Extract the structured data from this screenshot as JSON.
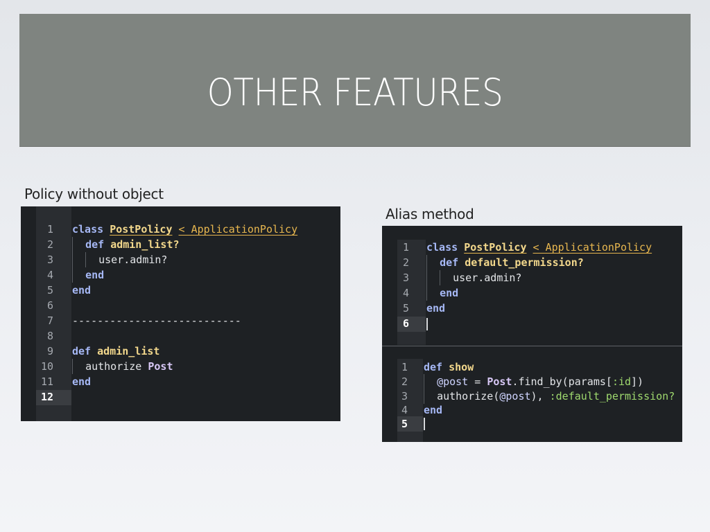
{
  "slide": {
    "title": "OTHER FEATURES"
  },
  "left_example": {
    "caption": "Policy without object",
    "line_numbers": [
      "1",
      "2",
      "3",
      "4",
      "5",
      "6",
      "7",
      "8",
      "9",
      "10",
      "11",
      "12"
    ],
    "lines": {
      "l1": {
        "kw": "class",
        "cls": "PostPolicy",
        "sup": "< ApplicationPolicy"
      },
      "l2": {
        "kw": "def",
        "fn": "admin_list?"
      },
      "l3": {
        "text": "user.admin?"
      },
      "l4": {
        "kw": "end"
      },
      "l5": {
        "kw": "end"
      },
      "l7": {
        "text": "---------------------------"
      },
      "l9": {
        "kw": "def",
        "fn": "admin_list"
      },
      "l10": {
        "text": "authorize",
        "const": "Post"
      },
      "l11": {
        "kw": "end"
      }
    }
  },
  "right_example": {
    "caption": "Alias method",
    "top_line_numbers": [
      "1",
      "2",
      "3",
      "4",
      "5",
      "6"
    ],
    "bottom_line_numbers": [
      "1",
      "2",
      "3",
      "4",
      "5"
    ],
    "top_lines": {
      "l1": {
        "kw": "class",
        "cls": "PostPolicy",
        "sup": "< ApplicationPolicy"
      },
      "l2": {
        "kw": "def",
        "fn": "default_permission?"
      },
      "l3": {
        "text": "user.admin?"
      },
      "l4": {
        "kw": "end"
      },
      "l5": {
        "kw": "end"
      }
    },
    "bottom_lines": {
      "l1": {
        "kw": "def",
        "fn": "show"
      },
      "l2": {
        "ivar": "@post",
        "op": " = ",
        "const": "Post",
        "rest": ".find_by(params[",
        "sym": ":id",
        "end": "])"
      },
      "l3": {
        "pre": "authorize(",
        "ivar": "@post",
        "post": "), ",
        "sym": ":default_permission?"
      },
      "l4": {
        "kw": "end"
      }
    }
  },
  "colors": {
    "banner": "#7f8480",
    "editor_bg": "#1e2124",
    "gutter_bg": "#2a2d31",
    "keyword": "#a6b8f5",
    "class_name": "#f3d88c",
    "superclass": "#e8b74f",
    "symbol": "#9fd96e"
  }
}
